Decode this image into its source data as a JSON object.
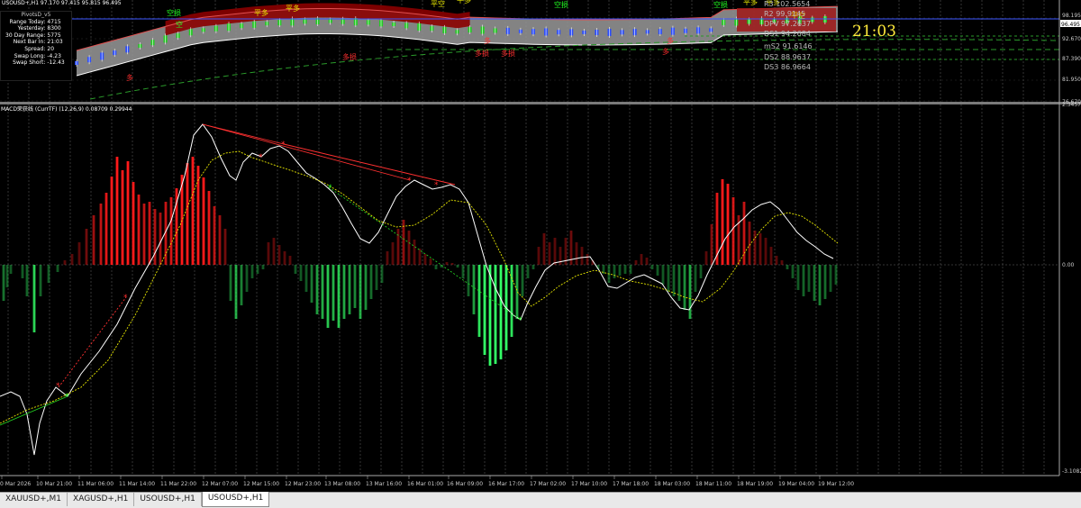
{
  "window": {
    "symbol_line": "USOUSD+,H1  97.170 97.415 95.815 96.495",
    "clock": "21:03"
  },
  "stats_panel": {
    "title": "PivotsD_v5",
    "rows": [
      {
        "label": "Range  Today:",
        "value": "4715"
      },
      {
        "label": "Yesterday:",
        "value": "8300"
      },
      {
        "label": "30 Day Range:",
        "value": "5775"
      },
      {
        "label": "Next Bar In:",
        "value": "21:03"
      },
      {
        "label": "Spread:",
        "value": "20"
      },
      {
        "label": "Swap  Long:",
        "value": "-4.23"
      },
      {
        "label": "Swap  Short:",
        "value": "-12.43"
      }
    ]
  },
  "pivot_levels": [
    {
      "label": "R3  102.5654"
    },
    {
      "label": "R2  99.9145"
    },
    {
      "label": "DPV  97.2637"
    },
    {
      "label": "DS1  94.2684"
    },
    {
      "label": "mS2  91.6146"
    },
    {
      "label": "DS2  88.9637"
    },
    {
      "label": "DS3  86.9664"
    }
  ],
  "price_axis": {
    "labels": [
      "98.195",
      "96.495",
      "92.670",
      "87.390",
      "81.950",
      "76.670"
    ],
    "current_price": "96.495"
  },
  "macd": {
    "label": "MACD荣获线 (CurrTF) (12,26,9) 0.08709 0.29944",
    "axis_labels": [
      "2.3457",
      "0.00",
      "-3.1082"
    ]
  },
  "signal_labels": [
    "空损",
    "平多",
    "空",
    "平多",
    "平空",
    "平多",
    "空损",
    "空损",
    "平多",
    "平多",
    "多",
    "多损",
    "多损",
    "多",
    "多损",
    "多",
    "平空",
    "多"
  ],
  "time_axis": {
    "labels": [
      "0 Mar 2026",
      "10 Mar 21:00",
      "11 Mar 06:00",
      "11 Mar 14:00",
      "11 Mar 22:00",
      "12 Mar 07:00",
      "12 Mar 15:00",
      "12 Mar 23:00",
      "13 Mar 08:00",
      "13 Mar 16:00",
      "16 Mar 01:00",
      "16 Mar 09:00",
      "16 Mar 17:00",
      "17 Mar 02:00",
      "17 Mar 10:00",
      "17 Mar 18:00",
      "18 Mar 03:00",
      "18 Mar 11:00",
      "18 Mar 19:00",
      "19 Mar 04:00",
      "19 Mar 12:00"
    ]
  },
  "tabs": [
    {
      "label": "XAUUSD+,M1",
      "active": false
    },
    {
      "label": "XAGUSD+,H1",
      "active": false
    },
    {
      "label": "USOUSD+,H1",
      "active": false
    },
    {
      "label": "USOUSD+,H1",
      "active": true
    }
  ],
  "colors": {
    "bull_hist": "#ff1a1a",
    "bear_hist": "#33ff66",
    "macd_line": "#ffffff",
    "signal_line": "#e6e600",
    "band_red": "#8b0000",
    "band_gray": "#9a9a9a",
    "grid": "#555555"
  }
}
